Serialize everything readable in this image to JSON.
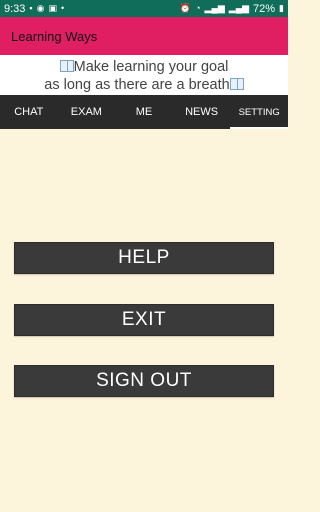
{
  "status_bar": {
    "time": "9:33",
    "battery": "72%"
  },
  "app_bar": {
    "title": "Learning Ways"
  },
  "banner": {
    "line1": "Make learning your goal",
    "line2": "as long as there are a breath"
  },
  "tabs": [
    {
      "label": "CHAT"
    },
    {
      "label": "EXAM"
    },
    {
      "label": "ME"
    },
    {
      "label": "NEWS"
    },
    {
      "label": "SETTING"
    }
  ],
  "buttons": {
    "help": "HELP",
    "exit": "EXIT",
    "sign_out": "SIGN OUT"
  }
}
